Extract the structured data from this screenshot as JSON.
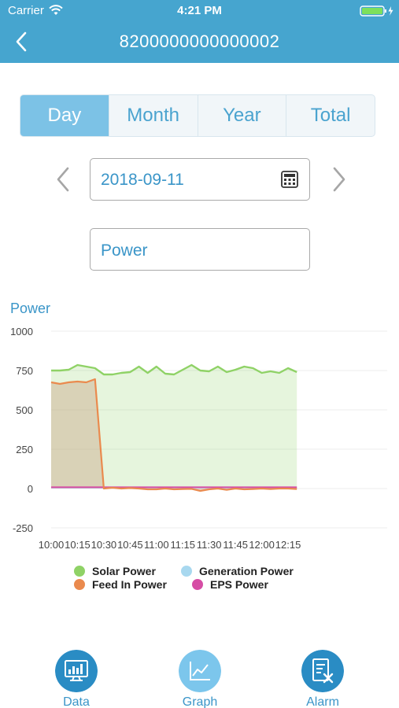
{
  "status": {
    "carrier": "Carrier",
    "time": "4:21 PM"
  },
  "nav": {
    "title": "8200000000000002"
  },
  "tabs": [
    {
      "label": "Day",
      "active": true
    },
    {
      "label": "Month",
      "active": false
    },
    {
      "label": "Year",
      "active": false
    },
    {
      "label": "Total",
      "active": false
    }
  ],
  "date": {
    "value": "2018-09-11"
  },
  "type_selector": {
    "value": "Power"
  },
  "chart_title": "Power",
  "colors": {
    "accent": "#46a5cf",
    "solar": "#8fd266",
    "feed_in": "#ea8a4e",
    "generation": "#a8d8ef",
    "eps": "#d64da5"
  },
  "chart_data": {
    "type": "area",
    "title": "",
    "ylabel": "Power",
    "xlabel": "",
    "ylim": [
      -250,
      1000
    ],
    "yticks": [
      "1000",
      "750",
      "500",
      "250",
      "0",
      "-250"
    ],
    "xticks": [
      "10:00",
      "10:15",
      "10:30",
      "10:45",
      "11:00",
      "11:15",
      "11:30",
      "11:45",
      "12:00",
      "12:15"
    ],
    "x_minutes": [
      0,
      5,
      10,
      15,
      20,
      25,
      30,
      35,
      40,
      45,
      50,
      55,
      60,
      65,
      70,
      75,
      80,
      85,
      90,
      95,
      100,
      105,
      110,
      115,
      120,
      125,
      130,
      135,
      140
    ],
    "series": [
      {
        "name": "Solar Power",
        "color": "#8fd266",
        "values": [
          750,
          750,
          755,
          785,
          775,
          765,
          725,
          725,
          735,
          740,
          775,
          735,
          775,
          730,
          725,
          755,
          785,
          750,
          745,
          775,
          740,
          755,
          775,
          765,
          735,
          745,
          735,
          765,
          740
        ]
      },
      {
        "name": "Feed In Power",
        "color": "#ea8a4e",
        "values": [
          675,
          665,
          675,
          680,
          675,
          695,
          0,
          5,
          0,
          3,
          0,
          -5,
          -5,
          0,
          -5,
          -3,
          -2,
          -15,
          -5,
          0,
          -8,
          0,
          -5,
          -3,
          0,
          -3,
          0,
          0,
          -3
        ]
      },
      {
        "name": "Generation Power",
        "color": "#a8d8ef",
        "values": [
          5,
          5,
          5,
          5,
          5,
          5,
          5,
          5,
          5,
          5,
          5,
          5,
          5,
          5,
          5,
          5,
          5,
          5,
          5,
          5,
          5,
          5,
          5,
          5,
          5,
          5,
          5,
          5,
          5
        ]
      },
      {
        "name": "EPS Power",
        "color": "#d64da5",
        "values": [
          8,
          8,
          8,
          8,
          8,
          8,
          8,
          8,
          8,
          8,
          8,
          8,
          8,
          8,
          8,
          8,
          8,
          8,
          8,
          8,
          8,
          8,
          8,
          8,
          8,
          8,
          8,
          8,
          8
        ]
      }
    ],
    "legend": [
      "Solar Power",
      "Generation Power",
      "Feed In Power",
      "EPS Power"
    ],
    "legend_position": "bottom",
    "grid": true
  },
  "bottom_tabs": [
    {
      "label": "Data",
      "icon": "data-icon"
    },
    {
      "label": "Graph",
      "icon": "graph-icon"
    },
    {
      "label": "Alarm",
      "icon": "alarm-icon"
    }
  ]
}
